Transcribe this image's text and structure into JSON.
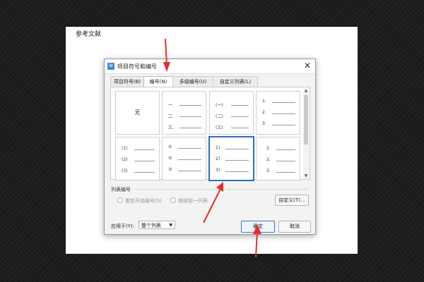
{
  "document": {
    "heading": "参考文献"
  },
  "dialog": {
    "title": "项目符号和编号",
    "tabs": [
      {
        "label": "项目符号(B)"
      },
      {
        "label": "编号(N)",
        "active": true
      },
      {
        "label": "多级编号(U)"
      },
      {
        "label": "自定义列表(L)"
      }
    ],
    "number_styles": {
      "none_label": "无",
      "chinese_lower": [
        "一.",
        "二.",
        "三."
      ],
      "chinese_paren": [
        "(一)",
        "(二)",
        "(三)"
      ],
      "arabic_dot_top": [
        "1.",
        "2.",
        "3."
      ],
      "arabic_paren": [
        "(1)",
        "(2)",
        "(3)"
      ],
      "circled": [
        "①",
        "②",
        "③"
      ],
      "arabic_half_paren": [
        "1)",
        "2)",
        "3)"
      ],
      "arabic_dot_bottom": [
        "1.",
        "2.",
        "3."
      ]
    },
    "list_numbering": {
      "label": "列表编号",
      "restart": "重新开始编号(S)",
      "continue": "继续前一列表",
      "customize_button": "自定义(T)..."
    },
    "apply_to": {
      "label": "应用于(Y):",
      "value": "整个列表"
    },
    "ok_button": "确定",
    "cancel_button": "取消"
  },
  "colors": {
    "accent": "#2b6cc2",
    "arrow": "#e0302a"
  }
}
